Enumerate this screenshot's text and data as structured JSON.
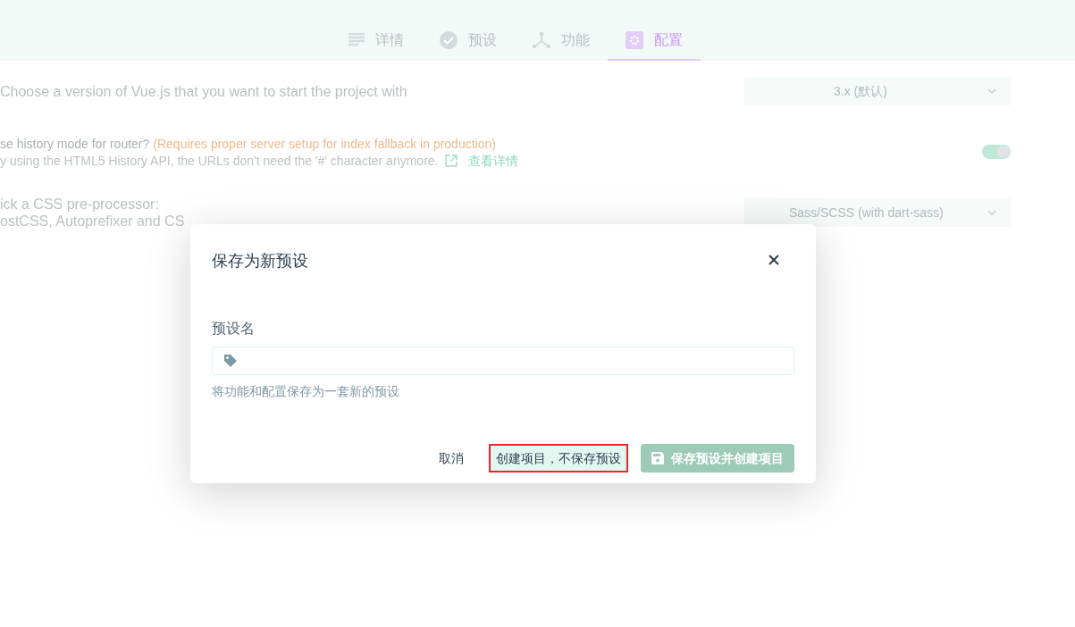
{
  "tabs": [
    {
      "label": "详情",
      "selected": false
    },
    {
      "label": "预设",
      "selected": false
    },
    {
      "label": "功能",
      "selected": false
    },
    {
      "label": "配置",
      "selected": true
    }
  ],
  "settings": [
    {
      "kind": "select",
      "title": "Choose a version of Vue.js that you want to start the project with",
      "value": "3.x (默认)"
    },
    {
      "kind": "toggle",
      "title": "se history mode for router?",
      "warning": "(Requires proper server setup for index fallback in production)",
      "description": "y using the HTML5 History API, the URLs don't need the '#' character anymore.",
      "link": "查看详情",
      "on": true
    },
    {
      "kind": "select",
      "title": "ick a CSS pre-processor:",
      "description": "ostCSS, Autoprefixer and CS",
      "value": "Sass/SCSS (with dart-sass)"
    }
  ],
  "dialog": {
    "title": "保存为新预设",
    "field_label": "预设名",
    "hint": "将功能和配置保存为一套新的预设",
    "buttons": [
      {
        "kind": "plain",
        "label": "取消",
        "highlighted": false,
        "disabled": false
      },
      {
        "kind": "secondary",
        "label": "创建项目，不保存预设",
        "highlighted": true,
        "disabled": false
      },
      {
        "kind": "primary",
        "label": "保存预设并创建项目",
        "highlighted": false,
        "disabled": true
      }
    ]
  }
}
